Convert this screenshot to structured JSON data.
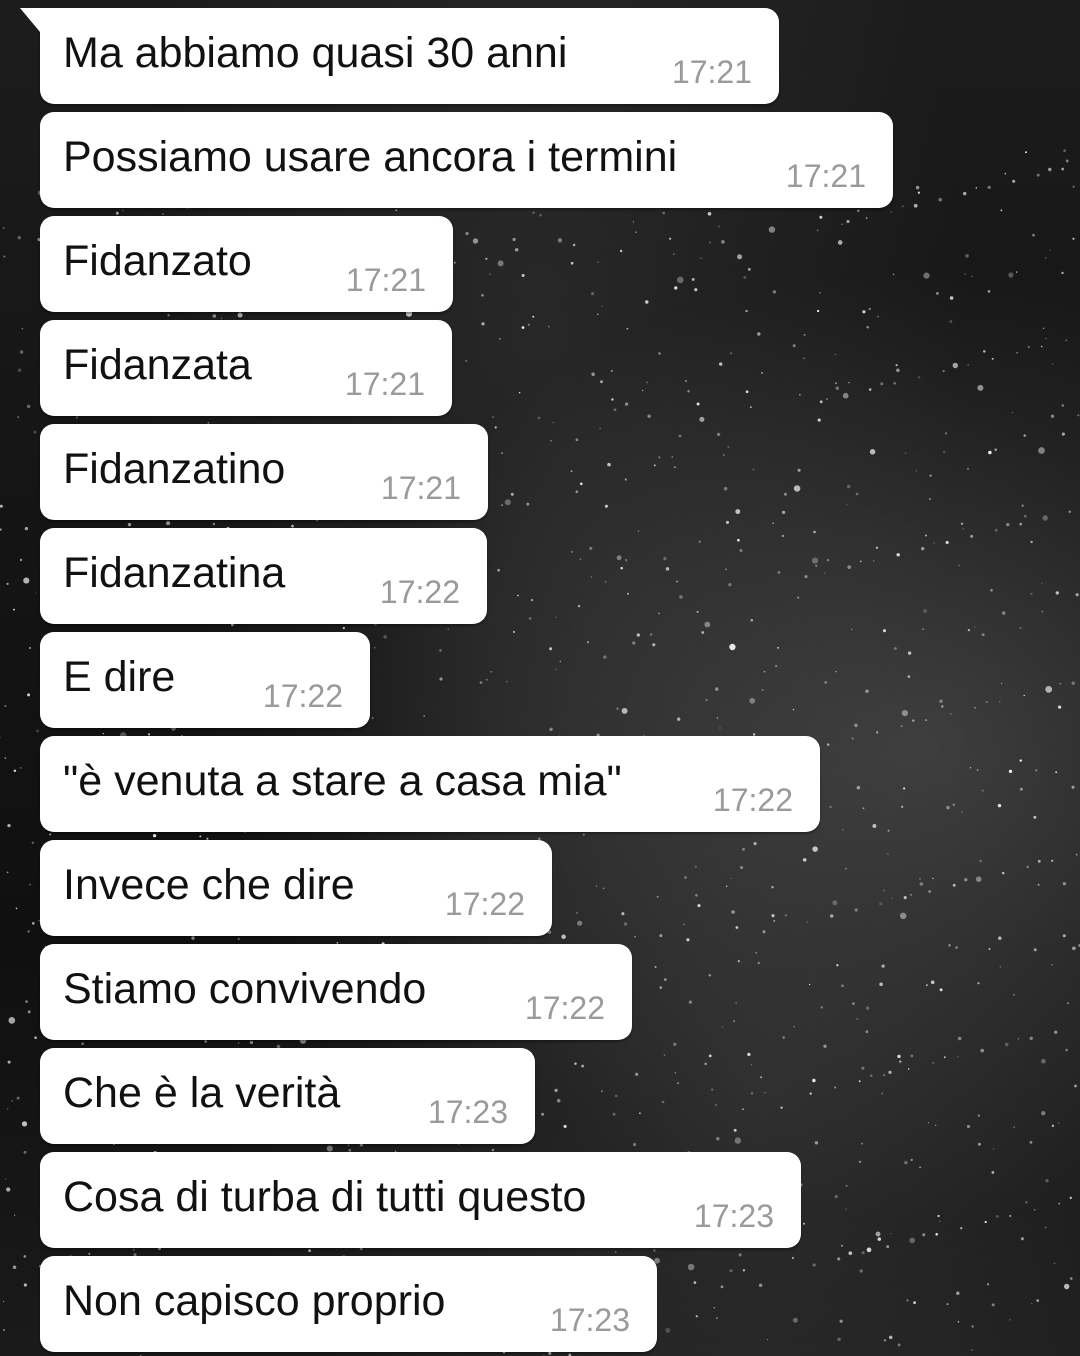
{
  "chat": {
    "messages": [
      {
        "text": "Ma abbiamo quasi 30 anni",
        "time": "17:21"
      },
      {
        "text": "Possiamo usare ancora i termini",
        "time": "17:21"
      },
      {
        "text": "Fidanzato",
        "time": "17:21"
      },
      {
        "text": "Fidanzata",
        "time": "17:21"
      },
      {
        "text": "Fidanzatino",
        "time": "17:21"
      },
      {
        "text": "Fidanzatina",
        "time": "17:22"
      },
      {
        "text": "E dire",
        "time": "17:22"
      },
      {
        "text": "\"è venuta a stare a casa mia\"",
        "time": "17:22"
      },
      {
        "text": "Invece che dire",
        "time": "17:22"
      },
      {
        "text": "Stiamo convivendo",
        "time": "17:22"
      },
      {
        "text": "Che è la verità",
        "time": "17:23"
      },
      {
        "text": "Cosa di turba di tutti questo",
        "time": "17:23"
      },
      {
        "text": "Non capisco proprio",
        "time": "17:23"
      }
    ]
  },
  "colors": {
    "bubble": "#ffffff",
    "text": "#111111",
    "time": "#9a9a9a",
    "wallpaper": "#141414"
  }
}
